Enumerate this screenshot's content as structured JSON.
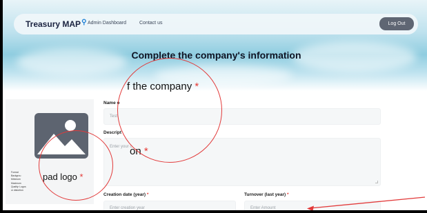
{
  "navbar": {
    "brand": "Treasury",
    "brand_bold": "MAP",
    "links": [
      "Admin Dashboard",
      "Contact us"
    ],
    "logout_label": "Log Out"
  },
  "page": {
    "title": "Complete the company's information"
  },
  "left_panel": {
    "upload_label": "pad logo",
    "notes": [
      "Format",
      "Backgrou",
      "Minimum",
      "Maximum",
      "Quality: Logos",
      "or distortion"
    ]
  },
  "form": {
    "name_label": "Name o",
    "name_value": "Test",
    "name_zoom": "f the company",
    "description_label": "Descript",
    "description_placeholder": "Enter your c",
    "description_zoom": "on",
    "creation_label": "Creation date (year)",
    "creation_placeholder": "Enter creation year",
    "turnover_label": "Turnover (last year)",
    "turnover_placeholder": "Enter Amount",
    "required_mark": "*"
  },
  "annotations": {
    "circle_color": "#e23a3a",
    "arrow_color": "#e23a3a"
  }
}
